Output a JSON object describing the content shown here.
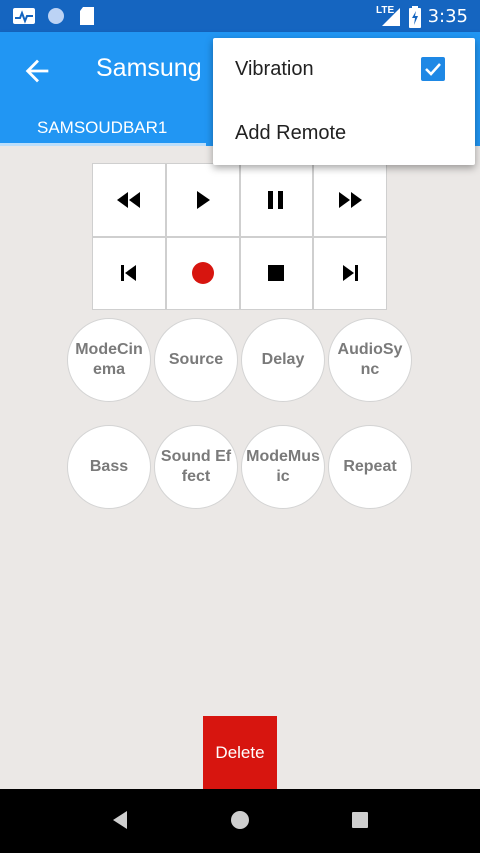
{
  "status_bar": {
    "time": "3:35",
    "network_label": "LTE",
    "left_icons": [
      "activity-icon",
      "circle-icon",
      "sd-card-icon"
    ],
    "right_icons": [
      "signal-icon",
      "battery-charging-icon"
    ]
  },
  "app_bar": {
    "title": "Samsung",
    "back_icon": "arrow-back-icon"
  },
  "tabs": [
    {
      "label": "SAMSOUDBAR1"
    }
  ],
  "controls": [
    {
      "name": "rewind-button",
      "icon": "rewind-icon"
    },
    {
      "name": "play-button",
      "icon": "play-icon"
    },
    {
      "name": "pause-button",
      "icon": "pause-icon"
    },
    {
      "name": "fast-forward-button",
      "icon": "fast-forward-icon"
    },
    {
      "name": "skip-previous-button",
      "icon": "skip-previous-icon"
    },
    {
      "name": "record-button",
      "icon": "record-icon",
      "color": "#d7150f"
    },
    {
      "name": "stop-button",
      "icon": "stop-icon"
    },
    {
      "name": "skip-next-button",
      "icon": "skip-next-icon"
    }
  ],
  "round_buttons": {
    "mode_cinema": "ModeCinema",
    "source": "Source",
    "delay": "Delay",
    "audio_sync": "AudioSync",
    "bass": "Bass",
    "sound_effect": "Sound Effect",
    "mode_music": "ModeMusic",
    "repeat": "Repeat"
  },
  "delete_label": "Delete",
  "menu": {
    "vibration_label": "Vibration",
    "vibration_checked": true,
    "add_remote_label": "Add Remote"
  },
  "nav_bar": [
    "back-nav-icon",
    "home-nav-icon",
    "recents-nav-icon"
  ],
  "colors": {
    "status_bar": "#1565c0",
    "app_bar": "#2196f3",
    "background": "#ebe8e6",
    "delete": "#d7150f",
    "checkbox": "#1e88e5"
  }
}
